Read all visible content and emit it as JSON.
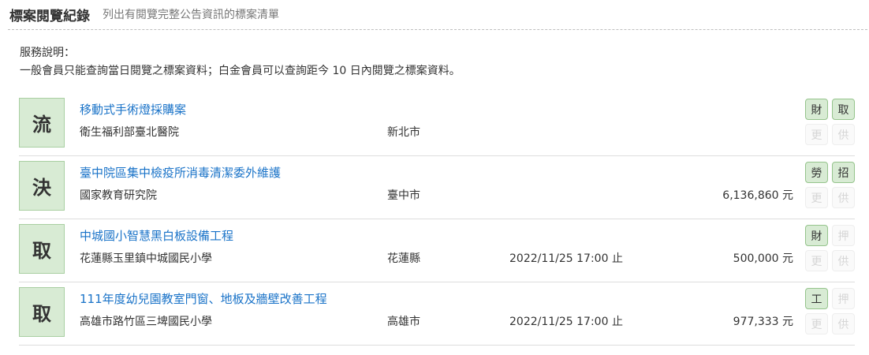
{
  "header": {
    "title": "標案閱覽紀錄",
    "subtitle": "列出有閱覽完整公告資訊的標案清單"
  },
  "notice": {
    "heading": "服務說明：",
    "body": "一般會員只能查詢當日閱覽之標案資料；白金會員可以查詢距今 10 日內閱覽之標案資料。"
  },
  "records": [
    {
      "status": "流",
      "title": "移動式手術燈採購案",
      "agency": "衛生福利部臺北醫院",
      "region": "新北市",
      "deadline": "",
      "amount": "",
      "tags": [
        {
          "label": "財",
          "active": true
        },
        {
          "label": "取",
          "active": true
        },
        {
          "label": "更",
          "active": false
        },
        {
          "label": "供",
          "active": false
        }
      ]
    },
    {
      "status": "決",
      "title": "臺中院區集中檢疫所消毒清潔委外維護",
      "agency": "國家教育研究院",
      "region": "臺中市",
      "deadline": "",
      "amount": "6,136,860 元",
      "tags": [
        {
          "label": "勞",
          "active": true
        },
        {
          "label": "招",
          "active": true
        },
        {
          "label": "更",
          "active": false
        },
        {
          "label": "供",
          "active": false
        }
      ]
    },
    {
      "status": "取",
      "title": "中城國小智慧黑白板設備工程",
      "agency": "花蓮縣玉里鎮中城國民小學",
      "region": "花蓮縣",
      "deadline": "2022/11/25 17:00 止",
      "amount": "500,000 元",
      "tags": [
        {
          "label": "財",
          "active": true
        },
        {
          "label": "押",
          "active": false
        },
        {
          "label": "更",
          "active": false
        },
        {
          "label": "供",
          "active": false
        }
      ]
    },
    {
      "status": "取",
      "title": "111年度幼兒園教室門窗、地板及牆壁改善工程",
      "agency": "高雄市路竹區三埤國民小學",
      "region": "高雄市",
      "deadline": "2022/11/25 17:00 止",
      "amount": "977,333 元",
      "tags": [
        {
          "label": "工",
          "active": true
        },
        {
          "label": "押",
          "active": false
        },
        {
          "label": "更",
          "active": false
        },
        {
          "label": "供",
          "active": false
        }
      ]
    }
  ]
}
